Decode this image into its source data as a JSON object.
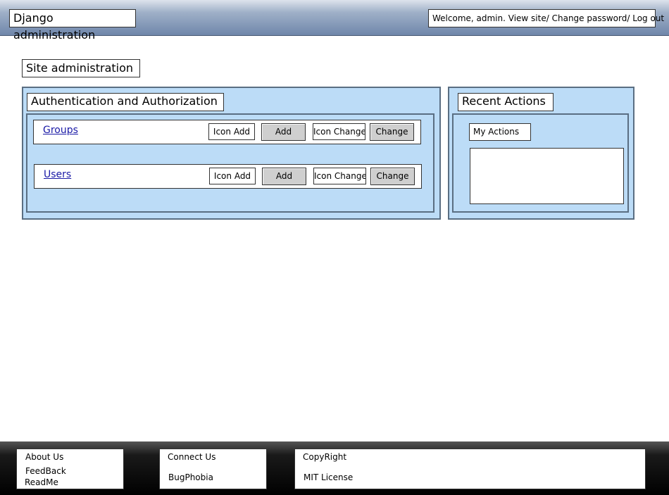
{
  "header": {
    "title": "Django administration",
    "welcome": "Welcome, admin.",
    "links": [
      "View site/",
      "Change password/",
      "Log out"
    ]
  },
  "main": {
    "heading": "Site administration",
    "app": {
      "title": "Authentication and Authorization",
      "models": [
        {
          "name": "Groups",
          "icon_add": "Icon Add",
          "add": "Add",
          "icon_change": "Icon Change",
          "change": "Change"
        },
        {
          "name": "Users",
          "icon_add": "Icon Add",
          "add": "Add",
          "icon_change": "Icon Change",
          "change": "Change"
        }
      ]
    },
    "recent": {
      "title": "Recent Actions",
      "my_actions": "My Actions"
    }
  },
  "footer": {
    "col1": [
      "About Us",
      "FeedBack",
      "ReadMe"
    ],
    "col2": [
      "Connect Us",
      "BugPhobia"
    ],
    "col3": [
      "CopyRight",
      "MIT License"
    ]
  }
}
